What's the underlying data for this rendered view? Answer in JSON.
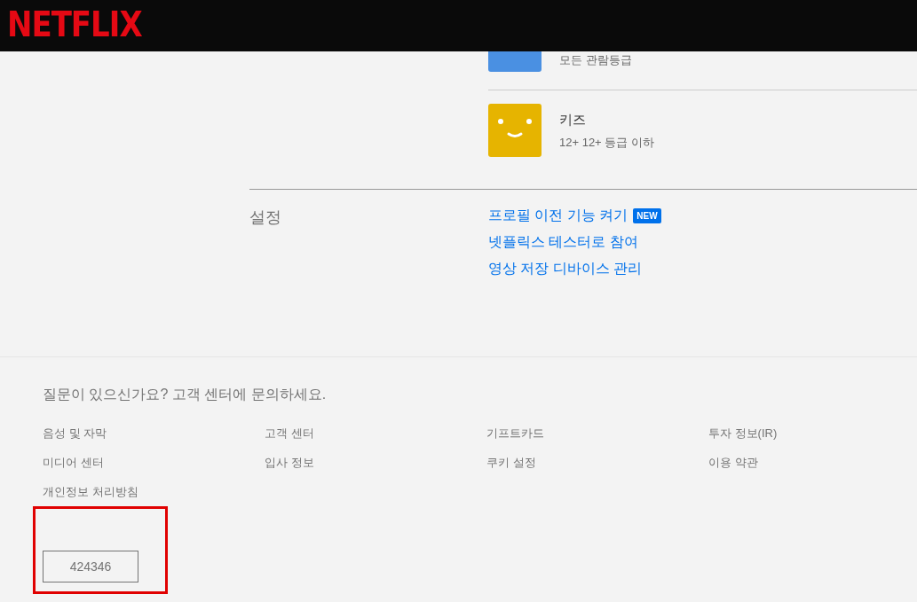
{
  "header": {
    "logo": "NETFLIX"
  },
  "profile_section": {
    "profiles": [
      {
        "rating": "모든 관람등급",
        "kind": "adult",
        "color": "#4a90e2"
      },
      {
        "name": "키즈",
        "rating": "12+ 12+ 등급 이하",
        "kind": "kids",
        "color": "#e6b400"
      }
    ]
  },
  "settings_section": {
    "title": "설정",
    "links": [
      {
        "label": "프로필 이전 기능 켜기",
        "badge": "NEW"
      },
      {
        "label": "넷플릭스 테스터로 참여"
      },
      {
        "label": "영상 저장 디바이스 관리"
      }
    ]
  },
  "footer": {
    "question": "질문이 있으신가요? 고객 센터에 문의하세요.",
    "links": [
      "음성 및 자막",
      "고객 센터",
      "기프트카드",
      "투자 정보(IR)",
      "미디어 센터",
      "입사 정보",
      "쿠키 설정",
      "이용 약관",
      "개인정보 처리방침"
    ],
    "service_code": "424346"
  }
}
